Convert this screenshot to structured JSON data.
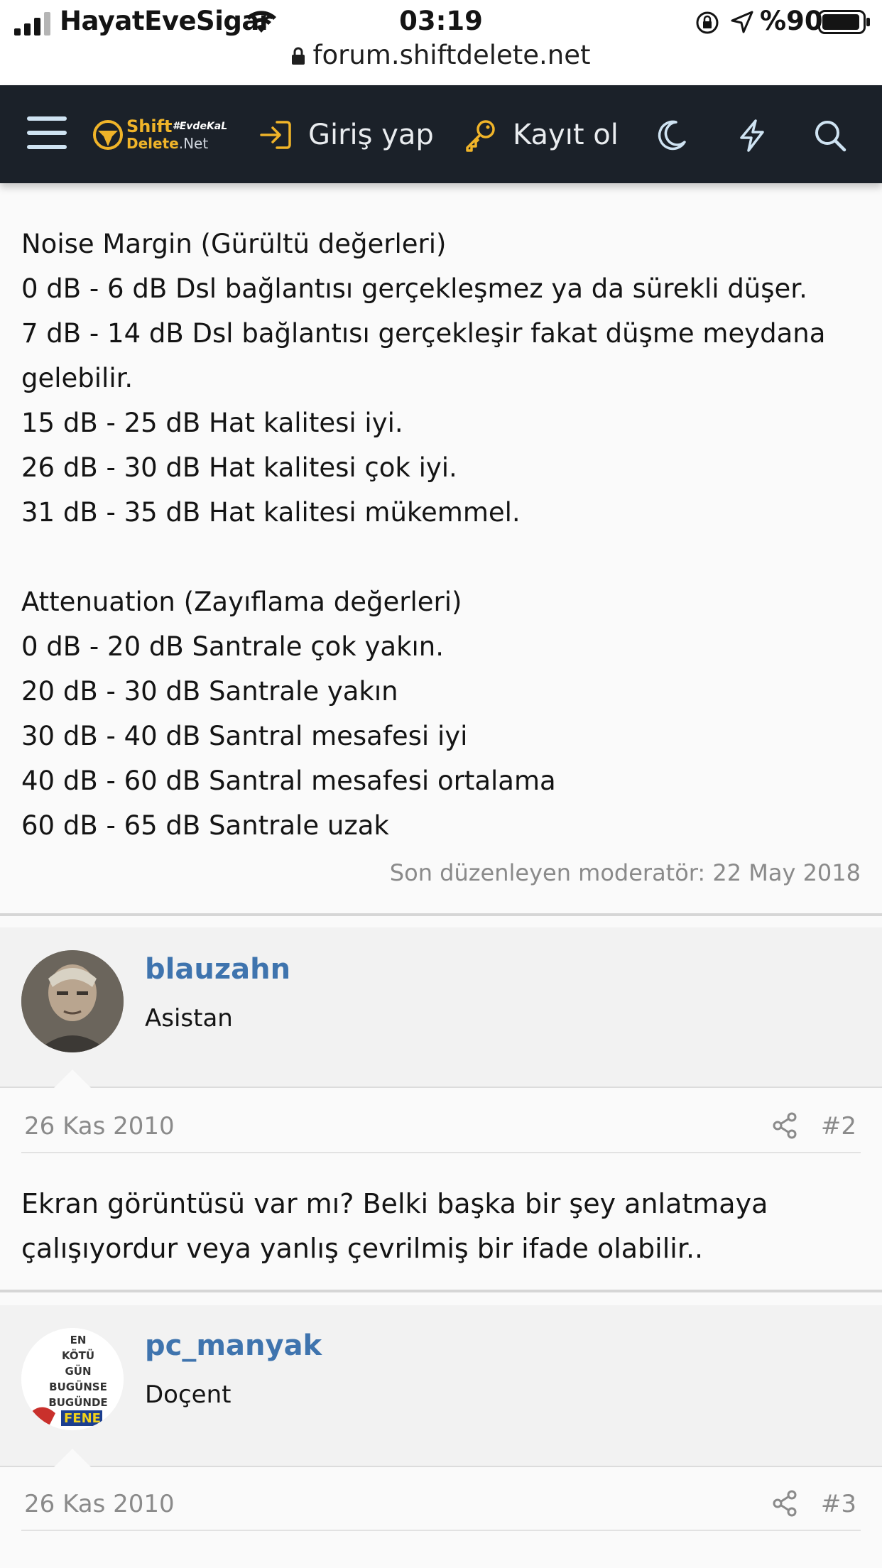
{
  "status_bar": {
    "carrier": "HayatEveSigar",
    "time": "03:19",
    "battery": "%90"
  },
  "browser": {
    "url": "forum.shiftdelete.net"
  },
  "header": {
    "logo_top": "Shift",
    "logo_tag": "#EvdeKaL",
    "logo_bottom": "Delete",
    "logo_suffix": ".Net",
    "login_label": "Giriş yap",
    "register_label": "Kayıt ol",
    "accent_color": "#f0b429",
    "bg_color": "#1b2129"
  },
  "post": {
    "lines": [
      "Noise Margin (Gürültü değerleri)",
      "0 dB - 6 dB Dsl bağlantısı gerçekleşmez ya da sürekli düşer.",
      "7 dB - 14 dB Dsl bağlantısı gerçekleşir fakat düşme meydana",
      "gelebilir.",
      "15 dB - 25 dB Hat kalitesi iyi.",
      "26 dB - 30 dB Hat kalitesi çok iyi.",
      "31 dB - 35 dB Hat kalitesi mükemmel.",
      "",
      "Attenuation (Zayıflama değerleri)",
      "0 dB - 20 dB Santrale çok yakın.",
      "20 dB - 30 dB Santrale yakın",
      "30 dB - 40 dB Santral mesafesi iyi",
      "40 dB - 60 dB Santral mesafesi ortalama",
      "60 dB - 65 dB Santrale uzak"
    ],
    "edited_note": "Son düzenleyen moderatör: 22 May 2018"
  },
  "replies": [
    {
      "username": "blauzahn",
      "user_title": "Asistan",
      "date": "26 Kas 2010",
      "number": "#2",
      "text_line1": "Ekran görüntüsü var mı? Belki başka bir şey anlatmaya",
      "text_line2": "çalışıyordur veya yanlış çevrilmiş bir ifade olabilir.."
    },
    {
      "username": "pc_manyak",
      "user_title": "Doçent",
      "avatar_text": [
        "EN",
        "KÖTÜ",
        "GÜN",
        "BUGÜNSE",
        "BUGÜNDE",
        "FENE"
      ],
      "date": "26 Kas 2010",
      "number": "#3"
    }
  ],
  "link_color": "#3f74ae"
}
